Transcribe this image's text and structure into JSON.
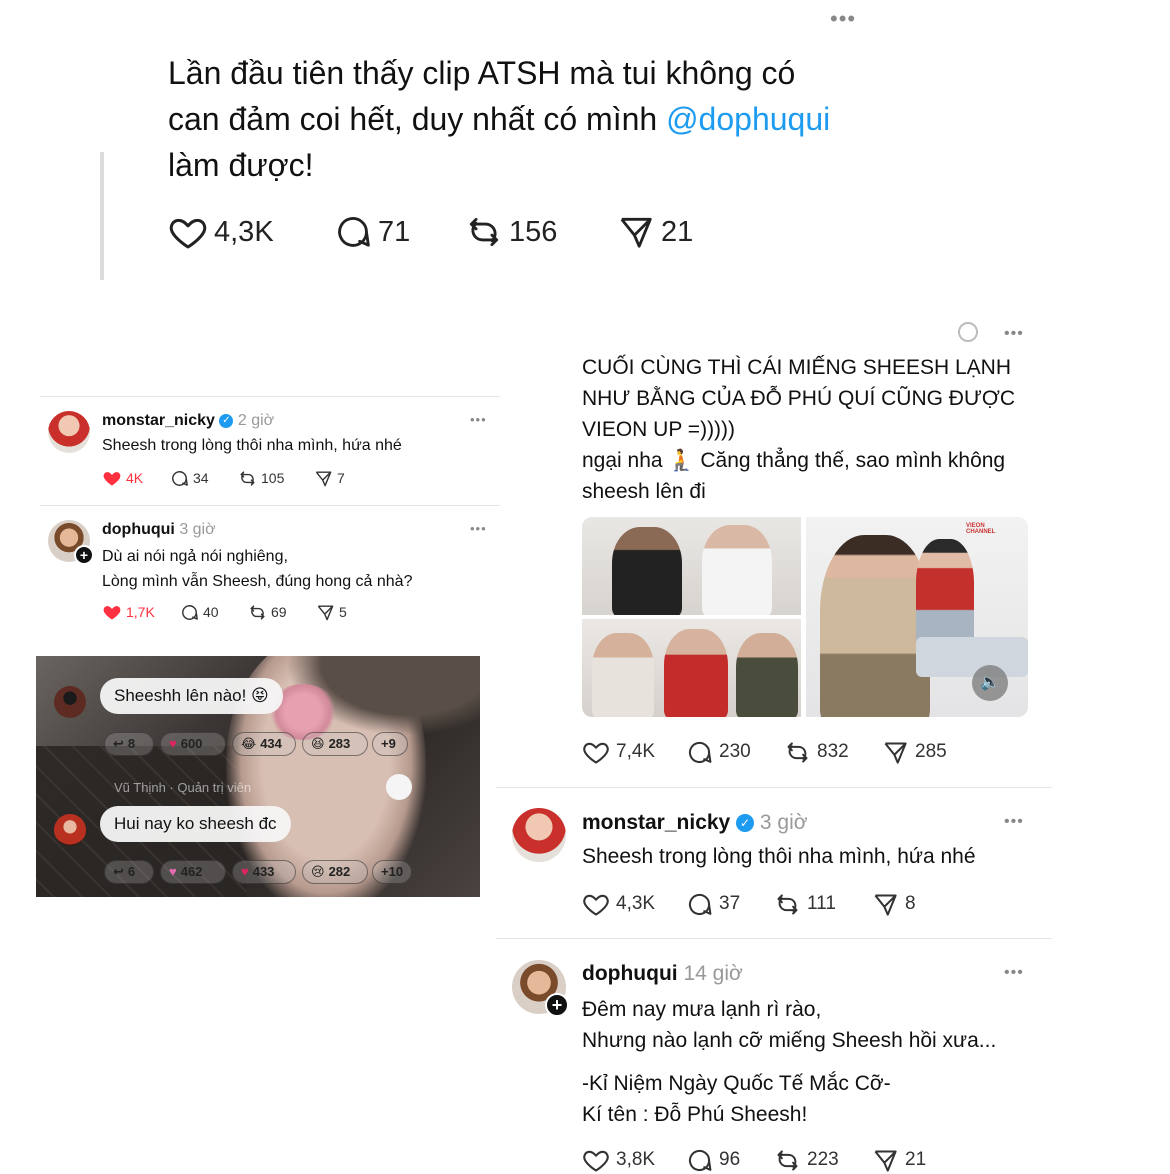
{
  "top_post": {
    "line1": "Lần đầu tiên thấy clip ATSH mà tui không có",
    "line2_prefix": "can đảm coi hết, duy nhất có mình ",
    "mention": "@dophuqui",
    "line3": "làm được!",
    "likes": "4,3K",
    "comments": "71",
    "reposts": "156",
    "shares": "21"
  },
  "left_thread": {
    "post1": {
      "user": "monstar_nicky",
      "time": "2 giờ",
      "text": "Sheesh trong lòng thôi nha mình, hứa nhé",
      "likes": "4K",
      "comments": "34",
      "reposts": "105",
      "shares": "7"
    },
    "post2": {
      "user": "dophuqui",
      "time": "3 giờ",
      "line1": "Dù ai nói ngả nói nghiêng,",
      "line2": "Lòng mình vẫn Sheesh, đúng hong cả nhà?",
      "likes": "1,7K",
      "comments": "40",
      "reposts": "69",
      "shares": "5"
    }
  },
  "video": {
    "comment1": "Sheeshh lên nào! 😝",
    "comment1_reacts": [
      "8",
      "600",
      "434",
      "283",
      "+9"
    ],
    "author2": "Vũ Thịnh · Quản trị viên",
    "comment2": "Hui nay ko sheesh đc",
    "comment2_reacts": [
      "6",
      "462",
      "433",
      "282",
      "+10"
    ]
  },
  "right_post": {
    "line1": "CUỐI CÙNG THÌ CÁI MIẾNG SHEESH LẠNH",
    "line2": "NHƯ BẰNG CỦA ĐỖ PHÚ QUÍ CŨNG ĐƯỢC",
    "line3": "VIEON UP =)))))",
    "line4": "ngại nha 🧎 Căng thẳng thế, sao mình không",
    "line5": "sheesh lên đi",
    "likes": "7,4K",
    "comments": "230",
    "reposts": "832",
    "shares": "285",
    "image_watermark": "VIEON CHANNEL"
  },
  "right_thread": {
    "post1": {
      "user": "monstar_nicky",
      "time": "3 giờ",
      "text": "Sheesh trong lòng thôi nha mình, hứa nhé",
      "likes": "4,3K",
      "comments": "37",
      "reposts": "111",
      "shares": "8"
    },
    "post2": {
      "user": "dophuqui",
      "time": "14 giờ",
      "line1": "Đêm nay mưa lạnh rì rào,",
      "line2": "Nhưng nào lạnh cỡ miếng Sheesh hồi xưa...",
      "line3": "-Kỉ Niệm Ngày Quốc Tế Mắc Cỡ-",
      "line4": "Kí tên : Đỗ Phú Sheesh!",
      "likes": "3,8K",
      "comments": "96",
      "reposts": "223",
      "shares": "21"
    }
  },
  "colors": {
    "mention": "#1d9bf0",
    "liked": "#ff3040",
    "text": "#111111",
    "muted": "#999999"
  }
}
